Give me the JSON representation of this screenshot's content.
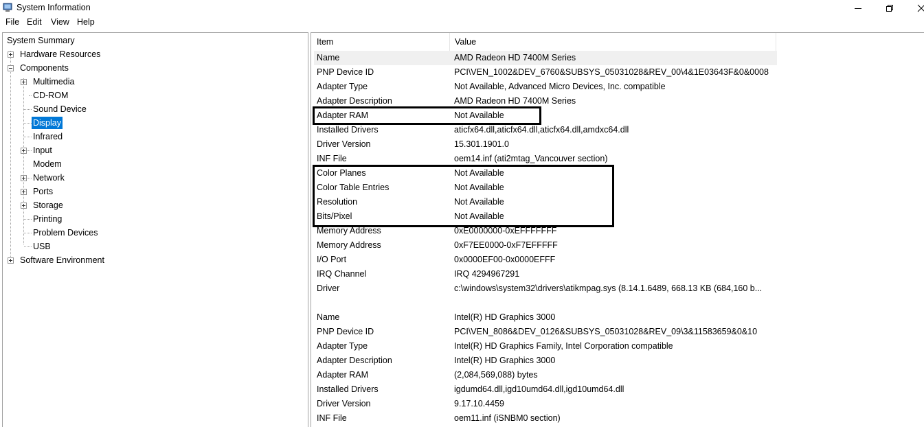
{
  "window": {
    "title": "System Information",
    "icon": "system-info-icon",
    "controls": [
      "minimize-icon",
      "restore-icon",
      "close-icon"
    ]
  },
  "menu": {
    "items": [
      "File",
      "Edit",
      "View",
      "Help"
    ]
  },
  "tree": {
    "root": "System Summary",
    "nodes": [
      {
        "label": "Hardware Resources",
        "expander": "plus"
      },
      {
        "label": "Components",
        "expander": "minus"
      },
      {
        "label": "Multimedia",
        "expander": "plus"
      },
      {
        "label": "CD-ROM",
        "expander": "none"
      },
      {
        "label": "Sound Device",
        "expander": "none"
      },
      {
        "label": "Display",
        "expander": "none",
        "selected": true
      },
      {
        "label": "Infrared",
        "expander": "none"
      },
      {
        "label": "Input",
        "expander": "plus"
      },
      {
        "label": "Modem",
        "expander": "none"
      },
      {
        "label": "Network",
        "expander": "plus"
      },
      {
        "label": "Ports",
        "expander": "plus"
      },
      {
        "label": "Storage",
        "expander": "plus"
      },
      {
        "label": "Printing",
        "expander": "none"
      },
      {
        "label": "Problem Devices",
        "expander": "none"
      },
      {
        "label": "USB",
        "expander": "none"
      },
      {
        "label": "Software Environment",
        "expander": "plus"
      }
    ]
  },
  "list": {
    "columns": [
      "Item",
      "Value"
    ],
    "rows": [
      {
        "item": "Name",
        "value": "AMD Radeon HD 7400M Series"
      },
      {
        "item": "PNP Device ID",
        "value": "PCI\\VEN_1002&DEV_6760&SUBSYS_05031028&REV_00\\4&1E03643F&0&0008"
      },
      {
        "item": "Adapter Type",
        "value": "Not Available, Advanced Micro Devices, Inc. compatible"
      },
      {
        "item": "Adapter Description",
        "value": "AMD Radeon HD 7400M Series"
      },
      {
        "item": "Adapter RAM",
        "value": "Not Available"
      },
      {
        "item": "Installed Drivers",
        "value": "aticfx64.dll,aticfx64.dll,aticfx64.dll,amdxc64.dll"
      },
      {
        "item": "Driver Version",
        "value": "15.301.1901.0"
      },
      {
        "item": "INF File",
        "value": "oem14.inf (ati2mtag_Vancouver section)"
      },
      {
        "item": "Color Planes",
        "value": "Not Available"
      },
      {
        "item": "Color Table Entries",
        "value": "Not Available"
      },
      {
        "item": "Resolution",
        "value": "Not Available"
      },
      {
        "item": "Bits/Pixel",
        "value": "Not Available"
      },
      {
        "item": "Memory Address",
        "value": "0xE0000000-0xEFFFFFFF"
      },
      {
        "item": "Memory Address",
        "value": "0xF7EE0000-0xF7EFFFFF"
      },
      {
        "item": "I/O Port",
        "value": "0x0000EF00-0x0000EFFF"
      },
      {
        "item": "IRQ Channel",
        "value": "IRQ 4294967291"
      },
      {
        "item": "Driver",
        "value": "c:\\windows\\system32\\drivers\\atikmpag.sys (8.14.1.6489, 668.13 KB (684,160 b..."
      },
      {
        "item": "",
        "value": ""
      },
      {
        "item": "Name",
        "value": "Intel(R) HD Graphics 3000"
      },
      {
        "item": "PNP Device ID",
        "value": "PCI\\VEN_8086&DEV_0126&SUBSYS_05031028&REV_09\\3&11583659&0&10"
      },
      {
        "item": "Adapter Type",
        "value": "Intel(R) HD Graphics Family, Intel Corporation compatible"
      },
      {
        "item": "Adapter Description",
        "value": "Intel(R) HD Graphics 3000"
      },
      {
        "item": "Adapter RAM",
        "value": "(2,084,569,088) bytes"
      },
      {
        "item": "Installed Drivers",
        "value": "igdumd64.dll,igd10umd64.dll,igd10umd64.dll"
      },
      {
        "item": "Driver Version",
        "value": "9.17.10.4459"
      },
      {
        "item": "INF File",
        "value": "oem11.inf (iSNBM0 section)"
      }
    ]
  },
  "colors": {
    "selection": "#0078d7",
    "first_row_bg": "#f0f0f0",
    "annotation_border": "#000000"
  }
}
